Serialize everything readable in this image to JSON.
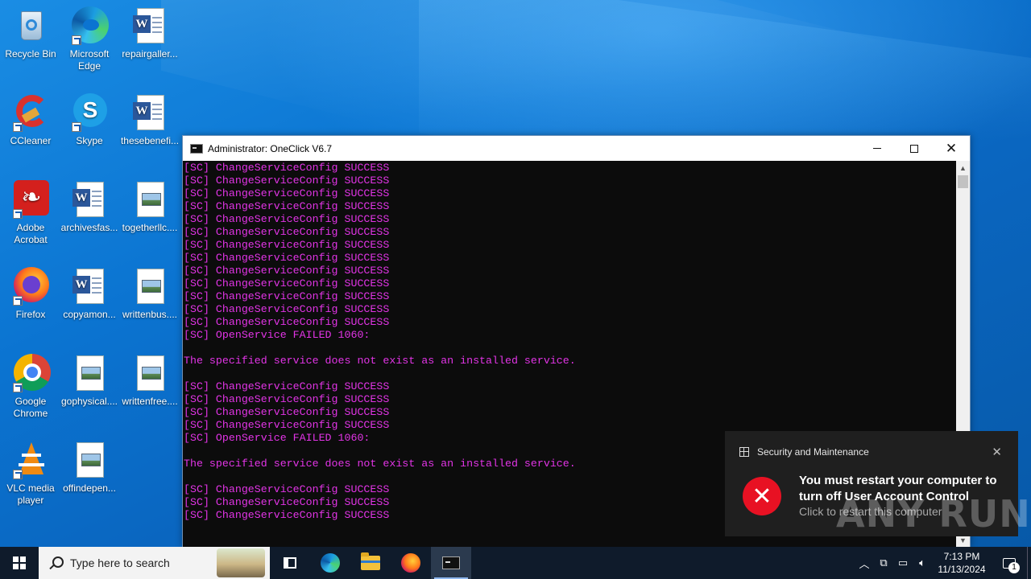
{
  "desktop": {
    "icons": [
      {
        "label": "Recycle Bin",
        "icon": "recycle-bin-icon"
      },
      {
        "label": "Microsoft Edge",
        "icon": "edge-icon"
      },
      {
        "label": "repairgaller...",
        "icon": "word-document-icon"
      },
      {
        "label": "CCleaner",
        "icon": "ccleaner-icon"
      },
      {
        "label": "Skype",
        "icon": "skype-icon"
      },
      {
        "label": "thesebenefi...",
        "icon": "word-document-icon"
      },
      {
        "label": "Adobe Acrobat",
        "icon": "acrobat-icon"
      },
      {
        "label": "archivesfas...",
        "icon": "word-document-icon"
      },
      {
        "label": "togetherllc....",
        "icon": "image-document-icon"
      },
      {
        "label": "Firefox",
        "icon": "firefox-icon"
      },
      {
        "label": "copyamon...",
        "icon": "word-document-icon"
      },
      {
        "label": "writtenbus....",
        "icon": "image-document-icon"
      },
      {
        "label": "Google Chrome",
        "icon": "chrome-icon"
      },
      {
        "label": "gophysical....",
        "icon": "image-document-icon"
      },
      {
        "label": "writtenfree....",
        "icon": "image-document-icon"
      },
      {
        "label": "VLC media player",
        "icon": "vlc-icon"
      },
      {
        "label": "offindepen...",
        "icon": "image-document-icon"
      }
    ]
  },
  "window": {
    "title": "Administrator:  OneClick V6.7",
    "controls": {
      "minimize": "minimize-icon",
      "maximize": "maximize-icon",
      "close": "close-icon"
    },
    "console_lines": [
      "[SC] ChangeServiceConfig SUCCESS",
      "[SC] ChangeServiceConfig SUCCESS",
      "[SC] ChangeServiceConfig SUCCESS",
      "[SC] ChangeServiceConfig SUCCESS",
      "[SC] ChangeServiceConfig SUCCESS",
      "[SC] ChangeServiceConfig SUCCESS",
      "[SC] ChangeServiceConfig SUCCESS",
      "[SC] ChangeServiceConfig SUCCESS",
      "[SC] ChangeServiceConfig SUCCESS",
      "[SC] ChangeServiceConfig SUCCESS",
      "[SC] ChangeServiceConfig SUCCESS",
      "[SC] ChangeServiceConfig SUCCESS",
      "[SC] ChangeServiceConfig SUCCESS",
      "[SC] OpenService FAILED 1060:",
      "",
      "The specified service does not exist as an installed service.",
      "",
      "[SC] ChangeServiceConfig SUCCESS",
      "[SC] ChangeServiceConfig SUCCESS",
      "[SC] ChangeServiceConfig SUCCESS",
      "[SC] ChangeServiceConfig SUCCESS",
      "[SC] OpenService FAILED 1060:",
      "",
      "The specified service does not exist as an installed service.",
      "",
      "[SC] ChangeServiceConfig SUCCESS",
      "[SC] ChangeServiceConfig SUCCESS",
      "[SC] ChangeServiceConfig SUCCESS"
    ],
    "text_color": "#e234e6"
  },
  "toast": {
    "app": "Security and Maintenance",
    "message": "You must restart your computer to turn off User Account Control",
    "action": "Click to restart this computer",
    "icon": "error-icon"
  },
  "watermark": "ANY RUN",
  "taskbar": {
    "search_placeholder": "Type here to search",
    "pinned": [
      "task-view-icon",
      "edge-icon",
      "file-explorer-icon",
      "firefox-icon",
      "cmd-icon"
    ],
    "tray": {
      "time": "7:13 PM",
      "date": "11/13/2024",
      "notification_count": "1"
    }
  }
}
